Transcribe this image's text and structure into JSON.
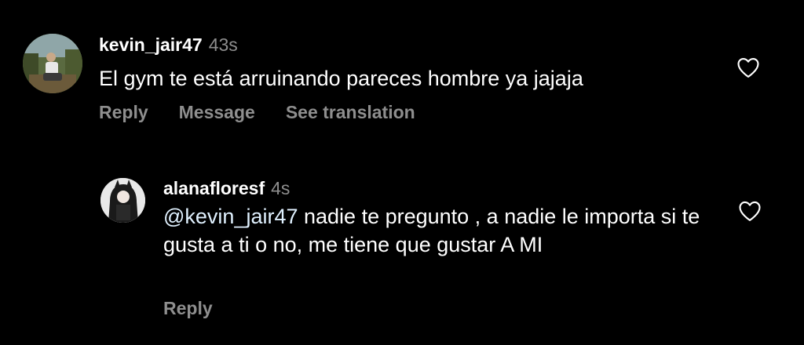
{
  "comments": [
    {
      "username": "kevin_jair47",
      "time": "43s",
      "text": "El gym te está arruinando pareces hombre ya jajaja",
      "actions": {
        "reply": "Reply",
        "message": "Message",
        "see_translation": "See translation"
      }
    },
    {
      "username": "alanafloresf",
      "time": "4s",
      "mention": "@kevin_jair47",
      "text": " nadie te pregunto , a nadie le importa si te gusta a ti o no, me tiene que gustar A MI",
      "actions": {
        "reply": "Reply"
      }
    }
  ],
  "icons": {
    "like": "heart-outline-icon"
  },
  "colors": {
    "background": "#000000",
    "text": "#ffffff",
    "secondary": "#8e8e8e",
    "mention": "#e0f1ff"
  }
}
